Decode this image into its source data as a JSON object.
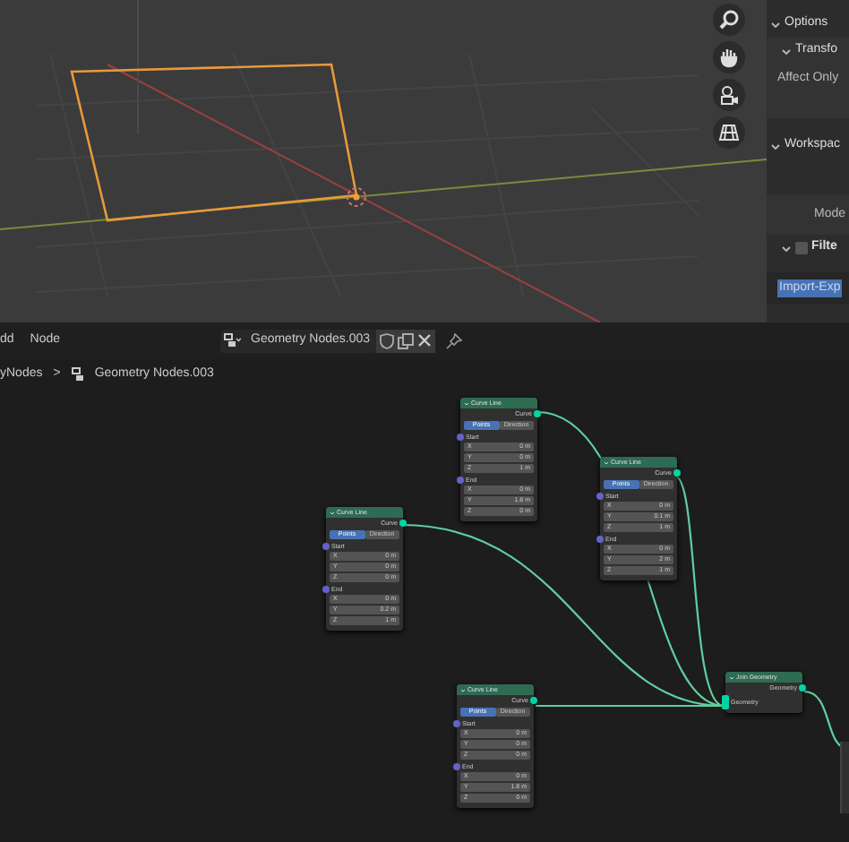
{
  "properties_panel": {
    "items": [
      {
        "kind": "section",
        "label": "Options",
        "expanded": true
      },
      {
        "kind": "subsection",
        "label": "Transfo",
        "expanded": true
      },
      {
        "kind": "label",
        "label": "Affect Only"
      },
      {
        "kind": "section",
        "label": "Workspac",
        "expanded": true
      },
      {
        "kind": "label",
        "label": "Mode"
      },
      {
        "kind": "checkbox_section",
        "label": "Filte",
        "expanded": true,
        "checked": false
      },
      {
        "kind": "list_item",
        "label": "Import-Exp",
        "selected": true
      }
    ]
  },
  "node_header": {
    "menus": [
      "dd",
      "Node"
    ],
    "node_group": "Geometry Nodes.003",
    "fake_user": false
  },
  "breadcrumb": {
    "parent": "yNodes",
    "separator": ">",
    "current": "Geometry Nodes.003"
  },
  "nodes": [
    {
      "title": "Curve Line",
      "output": "Curve",
      "modes": [
        {
          "label": "Points",
          "selected": true
        },
        {
          "label": "Direction",
          "selected": false
        }
      ],
      "inputs": [
        {
          "label": "Start",
          "fields": [
            {
              "axis": "X",
              "value": "0 m"
            },
            {
              "axis": "Y",
              "value": "0 m"
            },
            {
              "axis": "Z",
              "value": "1 m"
            }
          ]
        },
        {
          "label": "End",
          "fields": [
            {
              "axis": "X",
              "value": "0 m"
            },
            {
              "axis": "Y",
              "value": "1.8 m"
            },
            {
              "axis": "Z",
              "value": "0 m"
            }
          ]
        }
      ]
    },
    {
      "title": "Curve Line",
      "output": "Curve",
      "modes": [
        {
          "label": "Points",
          "selected": true
        },
        {
          "label": "Direction",
          "selected": false
        }
      ],
      "inputs": [
        {
          "label": "Start",
          "fields": [
            {
              "axis": "X",
              "value": "0 m"
            },
            {
              "axis": "Y",
              "value": "0.1 m"
            },
            {
              "axis": "Z",
              "value": "1 m"
            }
          ]
        },
        {
          "label": "End",
          "fields": [
            {
              "axis": "X",
              "value": "0 m"
            },
            {
              "axis": "Y",
              "value": "2 m"
            },
            {
              "axis": "Z",
              "value": "1 m"
            }
          ]
        }
      ]
    },
    {
      "title": "Curve Line",
      "output": "Curve",
      "modes": [
        {
          "label": "Points",
          "selected": true
        },
        {
          "label": "Direction",
          "selected": false
        }
      ],
      "inputs": [
        {
          "label": "Start",
          "fields": [
            {
              "axis": "X",
              "value": "0 m"
            },
            {
              "axis": "Y",
              "value": "0 m"
            },
            {
              "axis": "Z",
              "value": "0 m"
            }
          ]
        },
        {
          "label": "End",
          "fields": [
            {
              "axis": "X",
              "value": "0 m"
            },
            {
              "axis": "Y",
              "value": "0.2 m"
            },
            {
              "axis": "Z",
              "value": "1 m"
            }
          ]
        }
      ]
    },
    {
      "title": "Curve Line",
      "output": "Curve",
      "modes": [
        {
          "label": "Points",
          "selected": true
        },
        {
          "label": "Direction",
          "selected": false
        }
      ],
      "inputs": [
        {
          "label": "Start",
          "fields": [
            {
              "axis": "X",
              "value": "0 m"
            },
            {
              "axis": "Y",
              "value": "0 m"
            },
            {
              "axis": "Z",
              "value": "0 m"
            }
          ]
        },
        {
          "label": "End",
          "fields": [
            {
              "axis": "X",
              "value": "0 m"
            },
            {
              "axis": "Y",
              "value": "1.8 m"
            },
            {
              "axis": "Z",
              "value": "0 m"
            }
          ]
        }
      ]
    }
  ],
  "join_node": {
    "title": "Join Geometry",
    "output": "Geometry",
    "input": "Geometry"
  }
}
